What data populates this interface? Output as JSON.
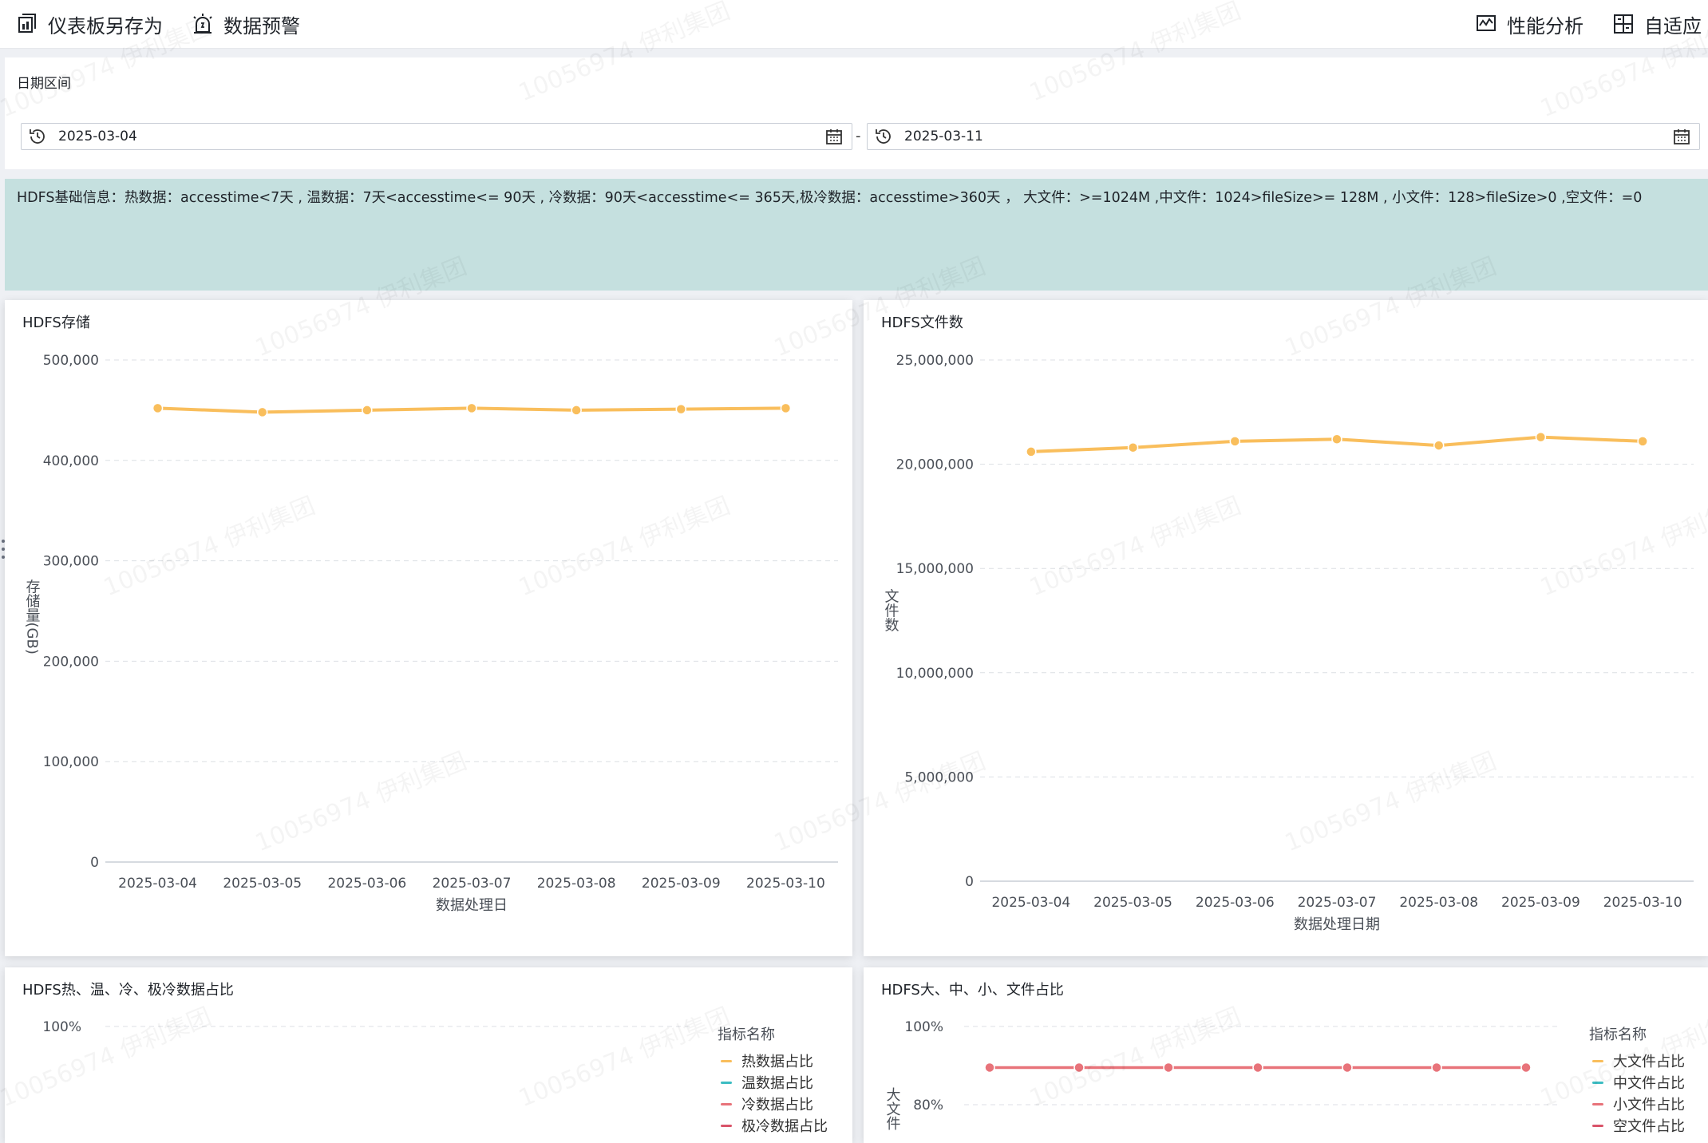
{
  "toolbar": {
    "save_as": "仪表板另存为",
    "alert": "数据预警",
    "performance": "性能分析",
    "adaptive": "自适应"
  },
  "filter": {
    "label": "日期区间",
    "start_date": "2025-03-04",
    "separator": "-",
    "end_date": "2025-03-11"
  },
  "banner": {
    "text": "HDFS基础信息：热数据：accesstime<7天 , 温数据：7天<accesstime<= 90天 , 冷数据：90天<accesstime<= 365天,极冷数据：accesstime>360天 ，  大文件：>=1024M ,中文件：1024>fileSize>= 128M , 小文件：128>fileSize>0 ,空文件：=0"
  },
  "watermark": "10056974 伊利集团",
  "colors": {
    "line_orange": "#f9be5c",
    "line_teal": "#3cbcc2",
    "line_red": "#e8737a",
    "line_pink": "#d9546a",
    "grid": "#dcdfe4",
    "banner": "#c5e0df"
  },
  "chart_data": [
    {
      "type": "line",
      "title": "HDFS存储",
      "ylabel": "存储量(GB)",
      "xlabel": "数据处理日",
      "x": [
        "2025-03-04",
        "2025-03-05",
        "2025-03-06",
        "2025-03-07",
        "2025-03-08",
        "2025-03-09",
        "2025-03-10"
      ],
      "yticks": [
        "0",
        "100,000",
        "200,000",
        "300,000",
        "400,000",
        "500,000"
      ],
      "ylim": [
        0,
        500000
      ],
      "series": [
        {
          "values": [
            452000,
            448000,
            450000,
            452000,
            450000,
            451000,
            452000
          ]
        }
      ]
    },
    {
      "type": "line",
      "title": "HDFS文件数",
      "ylabel": "文件数",
      "xlabel": "数据处理日期",
      "x": [
        "2025-03-04",
        "2025-03-05",
        "2025-03-06",
        "2025-03-07",
        "2025-03-08",
        "2025-03-09",
        "2025-03-10"
      ],
      "yticks": [
        "0",
        "5,000,000",
        "10,000,000",
        "15,000,000",
        "20,000,000",
        "25,000,000"
      ],
      "ylim": [
        0,
        25000000
      ],
      "series": [
        {
          "values": [
            20600000,
            20800000,
            21100000,
            21200000,
            20900000,
            21300000,
            21100000
          ]
        }
      ]
    },
    {
      "type": "line",
      "title": "HDFS热、温、冷、极冷数据占比",
      "yticks": [
        "100%"
      ],
      "legend_title": "指标名称",
      "legend": [
        "热数据占比",
        "温数据占比",
        "冷数据占比",
        "极冷数据占比"
      ],
      "series": []
    },
    {
      "type": "line",
      "title": "HDFS大、中、小、文件占比",
      "ylabel": "大文件",
      "yticks": [
        "100%",
        "80%"
      ],
      "legend_title": "指标名称",
      "legend": [
        "大文件占比",
        "中文件占比",
        "小文件占比",
        "空文件占比"
      ],
      "series": [
        {
          "name": "小文件占比",
          "values": [
            89.5,
            89.5,
            89.5,
            89.5,
            89.5,
            89.5,
            89.5
          ]
        }
      ]
    }
  ]
}
